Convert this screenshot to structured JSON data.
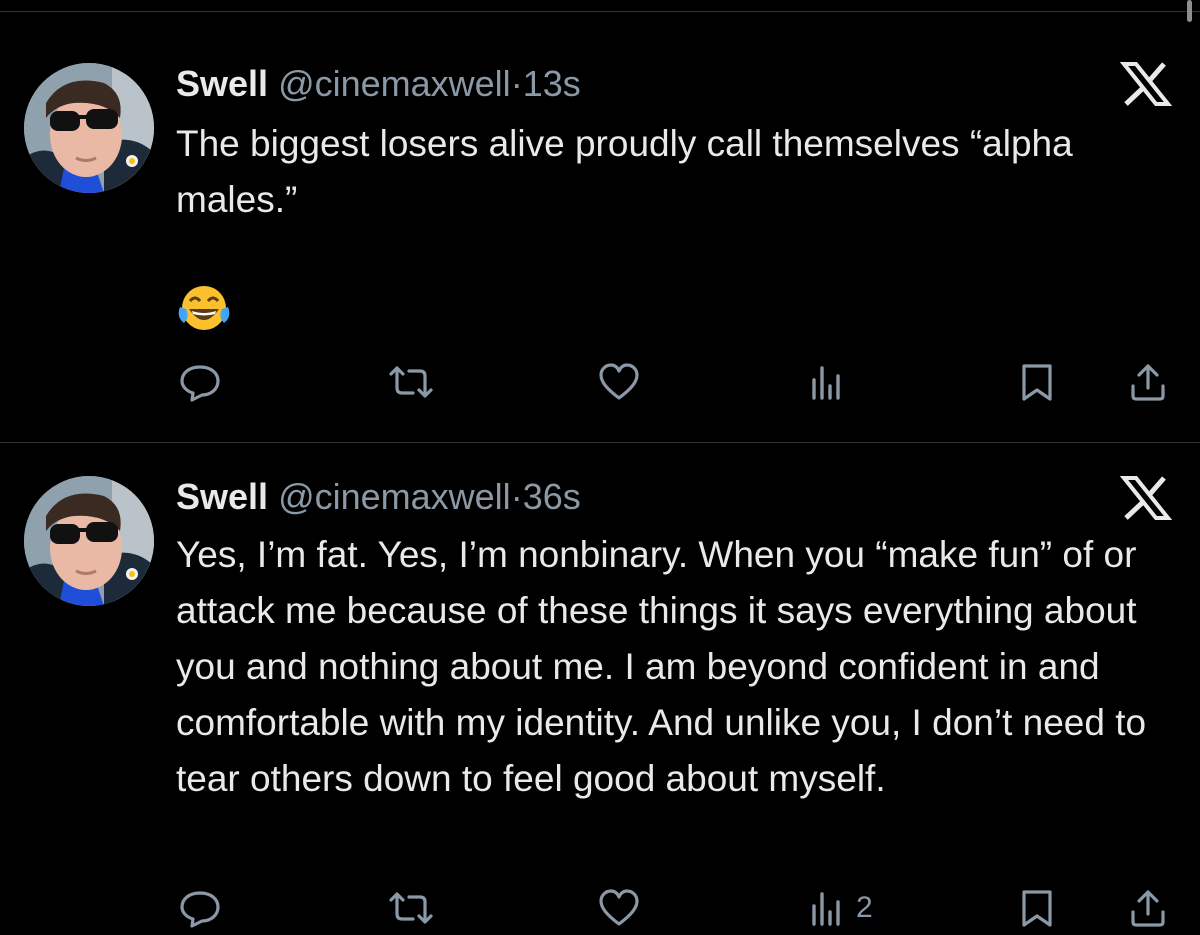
{
  "colors": {
    "background": "#000000",
    "text_primary": "#e7e9ea",
    "text_secondary": "#8b98a5",
    "divider": "#2f3336"
  },
  "tweets": [
    {
      "display_name": "Swell",
      "handle": "@cinemaxwell",
      "separator": "·",
      "time": "13s",
      "text": "The biggest losers alive proudly call themselves “alpha males.”",
      "emoji": "😂",
      "views": ""
    },
    {
      "display_name": "Swell",
      "handle": "@cinemaxwell",
      "separator": "·",
      "time": "36s",
      "text": "Yes, I’m fat. Yes, I’m nonbinary. When you “make fun” of or attack me because of these things it says everything about you and nothing about me. I am beyond confident in and comfortable with my identity. And unlike you, I don’t need to tear others down to feel good about myself.",
      "views": "2"
    }
  ],
  "icons": {
    "reply": "reply-icon",
    "repost": "repost-icon",
    "like": "like-icon",
    "views": "views-icon",
    "bookmark": "bookmark-icon",
    "share": "share-icon",
    "brand": "x-logo-icon",
    "emoji": "face-with-tears-of-joy-icon"
  }
}
